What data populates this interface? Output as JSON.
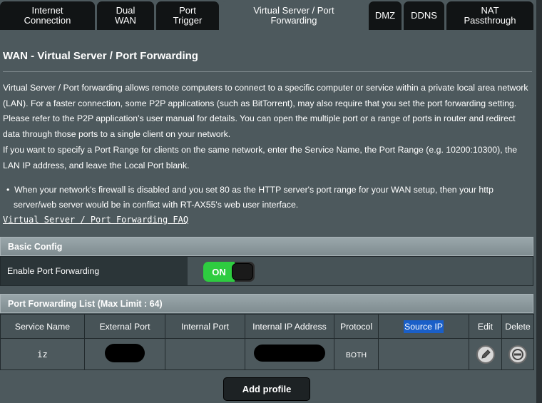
{
  "tabs": [
    {
      "label": "Internet\nConnection",
      "active": false
    },
    {
      "label": "Dual\nWAN",
      "active": false
    },
    {
      "label": "Port\nTrigger",
      "active": false
    },
    {
      "label": "Virtual Server / Port\nForwarding",
      "active": true
    },
    {
      "label": "DMZ",
      "active": false
    },
    {
      "label": "DDNS",
      "active": false
    },
    {
      "label": "NAT\nPassthrough",
      "active": false
    }
  ],
  "page_title": "WAN - Virtual Server / Port Forwarding",
  "description_1": "Virtual Server / Port forwarding allows remote computers to connect to a specific computer or service within a private local area network (LAN). For a faster connection, some P2P applications (such as BitTorrent), may also require that you set the port forwarding setting. Please refer to the P2P application's user manual for details. You can open the multiple port or a range of ports in router and redirect data through those ports to a single client on your network.",
  "description_2": "If you want to specify a Port Range for clients on the same network, enter the Service Name, the Port Range (e.g. 10200:10300), the LAN IP address, and leave the Local Port blank.",
  "bullet": "When your network's firewall is disabled and you set 80 as the HTTP server's port range for your WAN setup, then your http server/web server would be in conflict with RT-AX55's web user interface.",
  "faq_link": "Virtual Server / Port Forwarding FAQ",
  "basic_config": {
    "header": "Basic Config",
    "enable_label": "Enable Port Forwarding",
    "toggle_label": "ON",
    "toggle_color": "#2ecc40"
  },
  "port_list": {
    "header": "Port Forwarding List (Max Limit : 64)",
    "columns": [
      "Service Name",
      "External Port",
      "Internal Port",
      "Internal IP Address",
      "Protocol",
      "Source IP",
      "Edit",
      "Delete"
    ],
    "rows": [
      {
        "service_name": "iz",
        "external_port": "",
        "internal_port": "",
        "internal_ip": "",
        "protocol": "BOTH",
        "source_ip": ""
      }
    ]
  },
  "add_profile_label": "Add profile",
  "colors": {
    "background": "#4d595d",
    "tab_inactive": "#111415",
    "highlight": "#1a5fc8"
  },
  "icons": {
    "edit": "pencil-icon",
    "delete": "minus-circle-icon"
  }
}
